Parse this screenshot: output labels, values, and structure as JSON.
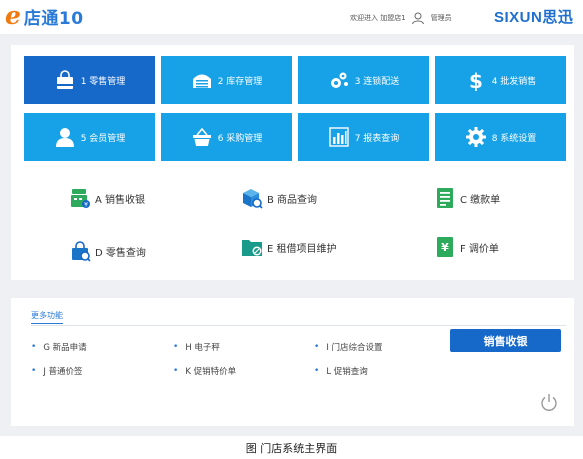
{
  "header": {
    "logo_mark": "e",
    "app_name": "店通10",
    "welcome": "欢迎进入 加盟店1",
    "user_role": "管理员",
    "brand": "SIXUN思迅"
  },
  "tiles": [
    {
      "label": "1 零售管理",
      "icon": "shopping-bag-icon",
      "active": true
    },
    {
      "label": "2 库存管理",
      "icon": "warehouse-icon"
    },
    {
      "label": "3 连锁配送",
      "icon": "gears-icon"
    },
    {
      "label": "4 批发销售",
      "icon": "dollar-icon"
    },
    {
      "label": "5 会员管理",
      "icon": "member-icon"
    },
    {
      "label": "6 采购管理",
      "icon": "basket-icon"
    },
    {
      "label": "7 报表查询",
      "icon": "bar-chart-icon"
    },
    {
      "label": "8 系统设置",
      "icon": "gear-icon"
    }
  ],
  "quick": [
    {
      "label": "A 销售收银",
      "icon": "cash-register-icon"
    },
    {
      "label": "B 商品查询",
      "icon": "product-search-icon"
    },
    {
      "label": "C 缴款单",
      "icon": "payment-slip-icon"
    },
    {
      "label": "D 零售查询",
      "icon": "retail-search-icon"
    },
    {
      "label": "E 租借项目维护",
      "icon": "lease-folder-icon"
    },
    {
      "label": "F 调价单",
      "icon": "price-adjust-icon"
    }
  ],
  "more": {
    "title": "更多功能",
    "items": [
      "G 新品申请",
      "H 电子秤",
      "I 门店综合设置",
      "J 普通价签",
      "K 促销特价单",
      "L 促销查询"
    ],
    "sale_button": "销售收银"
  },
  "caption": "图  门店系统主界面",
  "colors": {
    "tile": "#17a1e6",
    "tile_active": "#1769c9",
    "accent": "#2a7ad8",
    "logo_orange": "#f07a10"
  }
}
